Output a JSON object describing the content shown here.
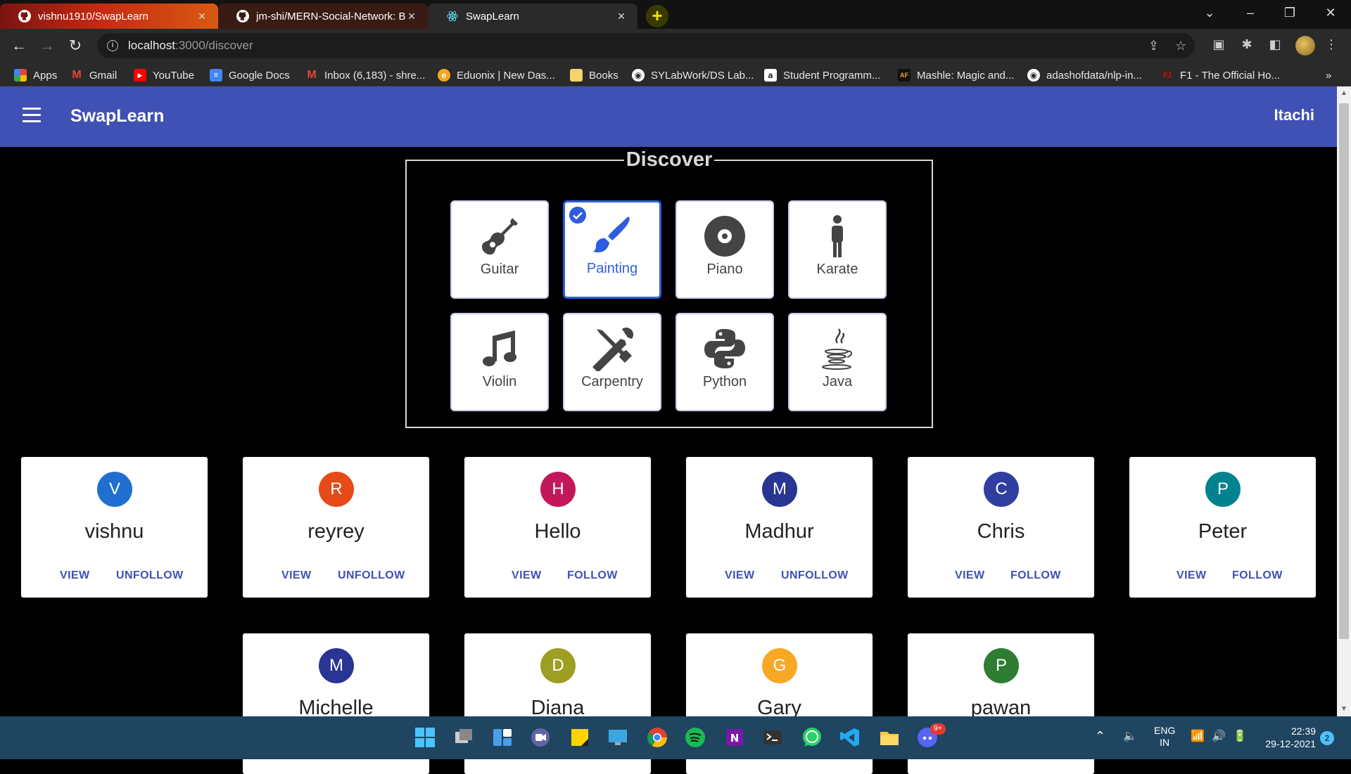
{
  "browser": {
    "tabs": [
      {
        "label": "vishnu1910/SwapLearn"
      },
      {
        "label": "jm-shi/MERN-Social-Network: Bu"
      },
      {
        "label": "SwapLearn"
      }
    ],
    "url_host": "localhost",
    "url_path": ":3000/discover",
    "bookmarks": [
      {
        "label": "Apps"
      },
      {
        "label": "Gmail"
      },
      {
        "label": "YouTube"
      },
      {
        "label": "Google Docs"
      },
      {
        "label": "Inbox (6,183) - shre..."
      },
      {
        "label": "Eduonix | New Das..."
      },
      {
        "label": "Books"
      },
      {
        "label": "SYLabWork/DS Lab..."
      },
      {
        "label": "Student Programm..."
      },
      {
        "label": "Mashle: Magic and..."
      },
      {
        "label": "adashofdata/nlp-in..."
      },
      {
        "label": "F1 - The Official Ho..."
      }
    ],
    "more_bookmarks": "»"
  },
  "app": {
    "title": "SwapLearn",
    "user": "Itachi"
  },
  "discover": {
    "legend": "Discover",
    "skills": [
      {
        "label": "Guitar",
        "selected": false
      },
      {
        "label": "Painting",
        "selected": true
      },
      {
        "label": "Piano",
        "selected": false
      },
      {
        "label": "Karate",
        "selected": false
      },
      {
        "label": "Violin",
        "selected": false
      },
      {
        "label": "Carpentry",
        "selected": false
      },
      {
        "label": "Python",
        "selected": false
      },
      {
        "label": "Java",
        "selected": false
      }
    ]
  },
  "users": [
    {
      "initial": "V",
      "name": "vishnu",
      "view": "VIEW",
      "action": "UNFOLLOW",
      "color": "#1e6fd0"
    },
    {
      "initial": "R",
      "name": "reyrey",
      "view": "VIEW",
      "action": "UNFOLLOW",
      "color": "#e64a19"
    },
    {
      "initial": "H",
      "name": "Hello",
      "view": "VIEW",
      "action": "FOLLOW",
      "color": "#c2185b"
    },
    {
      "initial": "M",
      "name": "Madhur",
      "view": "VIEW",
      "action": "UNFOLLOW",
      "color": "#283593"
    },
    {
      "initial": "C",
      "name": "Chris",
      "view": "VIEW",
      "action": "FOLLOW",
      "color": "#303f9f"
    },
    {
      "initial": "P",
      "name": "Peter",
      "view": "VIEW",
      "action": "FOLLOW",
      "color": "#00838f"
    },
    {
      "initial": "M",
      "name": "Michelle",
      "color": "#283593"
    },
    {
      "initial": "D",
      "name": "Diana",
      "color": "#9e9d24"
    },
    {
      "initial": "G",
      "name": "Gary",
      "color": "#f9a825"
    },
    {
      "initial": "P",
      "name": "pawan",
      "color": "#2e7d32"
    }
  ],
  "taskbar": {
    "lang_top": "ENG",
    "lang_bottom": "IN",
    "time": "22:39",
    "date": "29-12-2021",
    "notifications": "2",
    "discord_badge": "9+"
  },
  "colors": {
    "appbar": "#3f51b5",
    "accent": "#2f5dde",
    "action": "#3f51b5"
  }
}
